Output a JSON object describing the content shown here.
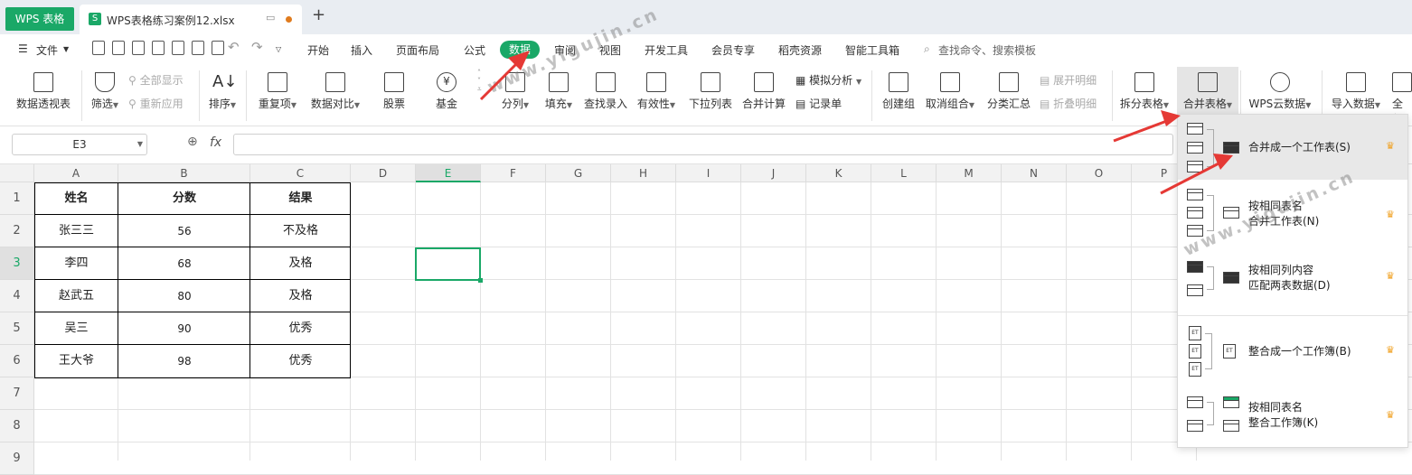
{
  "titlebar": {
    "app_tab": "WPS 表格",
    "file_name": "WPS表格练习案例12.xlsx",
    "new_tab": "+"
  },
  "menubar": {
    "file_label": "文件",
    "tabs": [
      "开始",
      "插入",
      "页面布局",
      "公式",
      "数据",
      "审阅",
      "视图",
      "开发工具",
      "会员专享",
      "稻壳资源",
      "智能工具箱"
    ],
    "search_placeholder": "查找命令、搜索模板"
  },
  "ribbon": {
    "pivot": "数据透视表",
    "filter": "筛选",
    "show_all": "全部显示",
    "reapply": "重新应用",
    "sort": "排序",
    "duplicates": "重复项",
    "compare": "数据对比",
    "stock": "股票",
    "fund": "基金",
    "split_col": "分列",
    "fill": "填充",
    "lookup_entry": "查找录入",
    "validity": "有效性",
    "dropdown_list": "下拉列表",
    "consolidate": "合并计算",
    "whatif": "模拟分析",
    "record_sheet": "记录单",
    "group": "创建组",
    "ungroup": "取消组合",
    "subtotal": "分类汇总",
    "expand": "展开明细",
    "collapse": "折叠明细",
    "split_table": "拆分表格",
    "merge_table": "合并表格",
    "wps_cloud": "WPS云数据",
    "import": "导入数据",
    "all": "全部"
  },
  "formula_bar": {
    "cell_ref": "E3",
    "fx": "fx",
    "value": ""
  },
  "columns": [
    "A",
    "B",
    "C",
    "D",
    "E",
    "F",
    "G",
    "H",
    "I",
    "J",
    "K",
    "L",
    "M",
    "N",
    "O",
    "P"
  ],
  "rows": [
    "1",
    "2",
    "3",
    "4",
    "5",
    "6",
    "7",
    "8",
    "9"
  ],
  "table": {
    "headers": [
      "姓名",
      "分数",
      "结果"
    ],
    "rows": [
      [
        "张三三",
        "56",
        "不及格"
      ],
      [
        "李四",
        "68",
        "及格"
      ],
      [
        "赵武五",
        "80",
        "及格"
      ],
      [
        "吴三",
        "90",
        "优秀"
      ],
      [
        "王大爷",
        "98",
        "优秀"
      ]
    ]
  },
  "merge_menu": {
    "items": [
      {
        "line1": "合并成一个工作表(S)",
        "line2": ""
      },
      {
        "line1": "按相同表名",
        "line2": "合并工作表(N)"
      },
      {
        "line1": "按相同列内容",
        "line2": "匹配两表数据(D)"
      },
      {
        "line1": "整合成一个工作簿(B)",
        "line2": ""
      },
      {
        "line1": "按相同表名",
        "line2": "整合工作簿(K)"
      }
    ]
  },
  "watermark": "www.yigujin.cn",
  "colors": {
    "accent": "#1aa867",
    "arrow": "#e53935"
  }
}
